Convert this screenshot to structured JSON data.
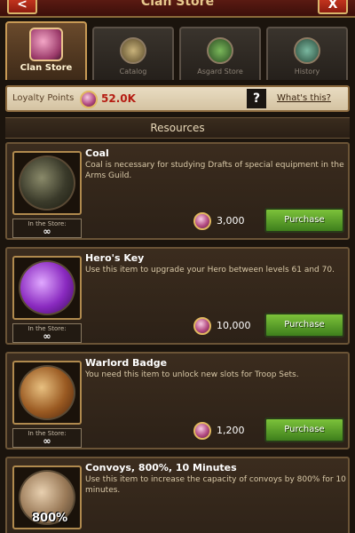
{
  "header": {
    "title": "Clan Store",
    "back_label": "<",
    "close_label": "X"
  },
  "tabs": [
    {
      "label": "Clan Store",
      "active": true,
      "icon": "chest-icon"
    },
    {
      "label": "Catalog",
      "active": false,
      "icon": "book-icon"
    },
    {
      "label": "Asgard Store",
      "active": false,
      "icon": "scroll-icon"
    },
    {
      "label": "History",
      "active": false,
      "icon": "history-icon"
    }
  ],
  "loyalty": {
    "label": "Loyalty Points",
    "value": "52.0K",
    "help_label": "?",
    "whats_this": "What's this?"
  },
  "section_title": "Resources",
  "items": [
    {
      "name": "Coal",
      "description": "Coal is necessary for studying Drafts of special equipment in the Arms Guild.",
      "in_store_label": "In the Store:",
      "in_store_value": "∞",
      "price": "3,000",
      "button": "Purchase",
      "icon": "coal-icon"
    },
    {
      "name": "Hero's Key",
      "description": "Use this item to upgrade your Hero between levels 61 and 70.",
      "in_store_label": "In the Store:",
      "in_store_value": "∞",
      "price": "10,000",
      "button": "Purchase",
      "icon": "key-icon"
    },
    {
      "name": "Warlord Badge",
      "description": "You need this item to unlock new slots for Troop Sets.",
      "in_store_label": "In the Store:",
      "in_store_value": "∞",
      "price": "1,200",
      "button": "Purchase",
      "icon": "badge-icon"
    },
    {
      "name": "Convoys, 800%, 10 Minutes",
      "description": "Use this item to increase the capacity of convoys by 800% for 10 minutes.",
      "overlay": "800%",
      "icon": "convoy-icon"
    }
  ]
}
